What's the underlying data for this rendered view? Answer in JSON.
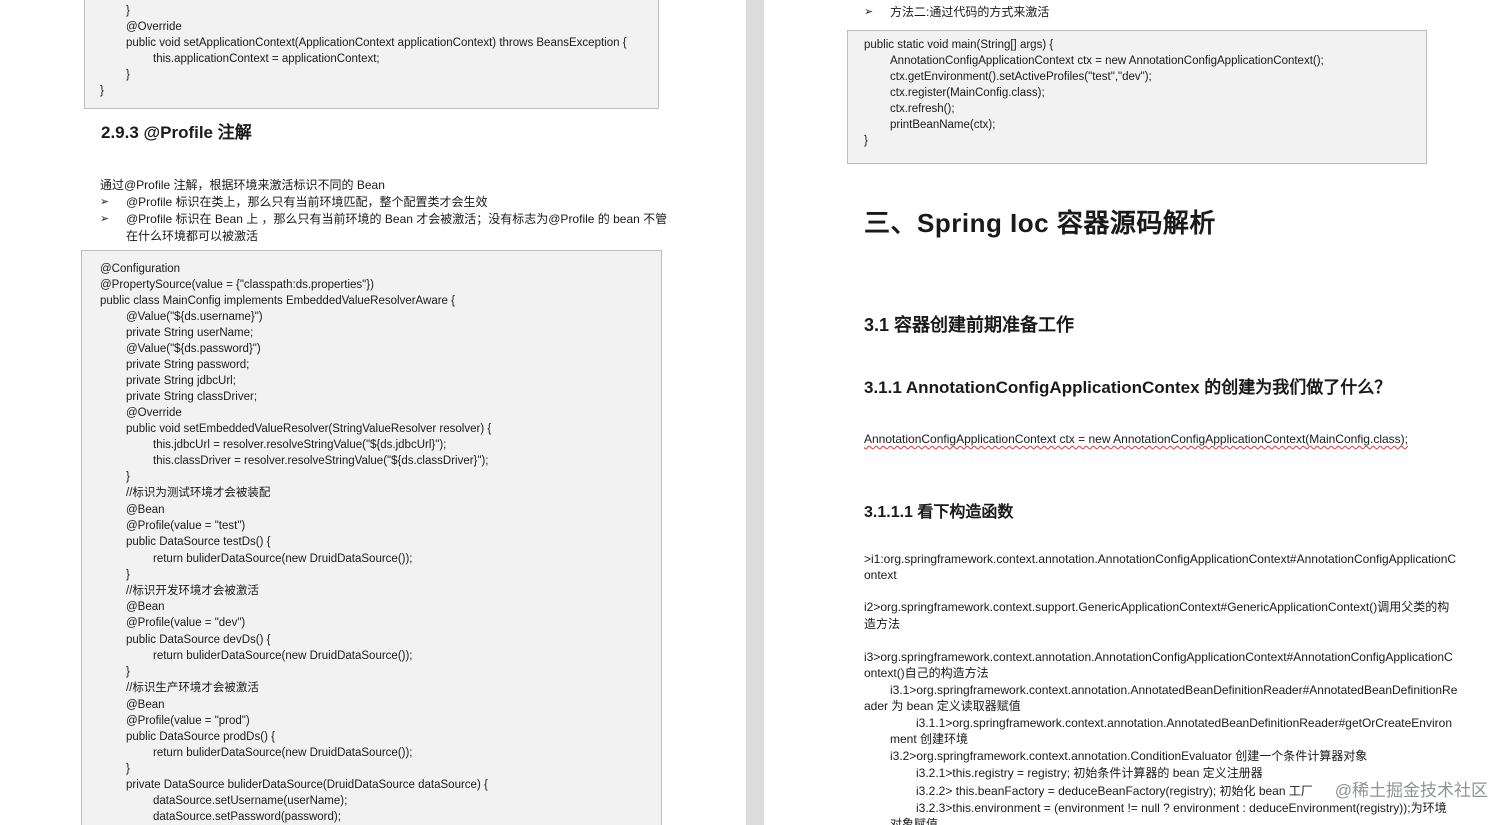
{
  "left_page": {
    "top_code_lines": [
      "}",
      "@Override",
      "public void setApplicationContext(ApplicationContext applicationContext) throws BeansException {",
      "this.applicationContext = applicationContext;",
      "}",
      "}"
    ],
    "section_heading": "2.9.3 @Profile 注解",
    "intro_text": "通过@Profile 注解，根据环境来激活标识不同的 Bean",
    "bullet_marker": "➢",
    "bullets": [
      "@Profile 标识在类上，那么只有当前环境匹配，整个配置类才会生效",
      "@Profile 标识在 Bean 上 ，那么只有当前环境的 Bean 才会被激活；没有标志为@Profile 的 bean  不管",
      "在什么环境都可以被激活"
    ],
    "code_lines": [
      "@Configuration",
      "@PropertySource(value = {\"classpath:ds.properties\"})",
      "public class MainConfig implements EmbeddedValueResolverAware {",
      "@Value(\"${ds.username}\")",
      "private String userName;",
      "@Value(\"${ds.password}\")",
      "private String password;",
      "private String jdbcUrl;",
      "private String classDriver;",
      "@Override",
      "public void setEmbeddedValueResolver(StringValueResolver resolver) {",
      "this.jdbcUrl = resolver.resolveStringValue(\"${ds.jdbcUrl}\");",
      "this.classDriver = resolver.resolveStringValue(\"${ds.classDriver}\");",
      "}",
      "//标识为测试环境才会被装配",
      "@Bean",
      "@Profile(value = \"test\")",
      "public DataSource testDs() {",
      "return buliderDataSource(new DruidDataSource());",
      "}",
      "//标识开发环境才会被激活",
      "@Bean",
      "@Profile(value = \"dev\")",
      "public DataSource devDs() {",
      "return buliderDataSource(new DruidDataSource());",
      "}",
      "//标识生产环境才会被激活",
      "@Bean",
      "@Profile(value = \"prod\")",
      "public DataSource prodDs() {",
      "return buliderDataSource(new DruidDataSource());",
      "}",
      "private DataSource buliderDataSource(DruidDataSource dataSource) {",
      "dataSource.setUsername(userName);",
      "dataSource.setPassword(password);"
    ]
  },
  "right_page": {
    "bullet_marker": "➢",
    "method_two": "方法二:通过代码的方式来激活",
    "code_lines": [
      "public static void main(String[] args) {",
      "AnnotationConfigApplicationContext ctx = new AnnotationConfigApplicationContext();",
      "ctx.getEnvironment().setActiveProfiles(\"test\",\"dev\");",
      "ctx.register(MainConfig.class);",
      "ctx.refresh();",
      "printBeanName(ctx);",
      "}"
    ],
    "chapter_heading": "三、Spring Ioc 容器源码解析",
    "heading_3_1": "3.1  容器创建前期准备工作",
    "heading_3_1_1": "3.1.1 AnnotationConfigApplicationContex 的创建为我们做了什么？",
    "ctx_line": "AnnotationConfigApplicationContext ctx = new AnnotationConfigApplicationContext(MainConfig.class);",
    "heading_3_1_1_1": "3.1.1.1 看下构造函数",
    "body_lines": [
      ">i1:org.springframework.context.annotation.AnnotationConfigApplicationContext#AnnotationConfigApplicationC",
      "ontext",
      "i2>org.springframework.context.support.GenericApplicationContext#GenericApplicationContext()调用父类的构",
      "造方法",
      "i3>org.springframework.context.annotation.AnnotationConfigApplicationContext#AnnotationConfigApplicationC",
      "ontext()自己的构造方法",
      "i3.1>org.springframework.context.annotation.AnnotatedBeanDefinitionReader#AnnotatedBeanDefinitionRe",
      "ader 为 bean 定义读取器赋值",
      "i3.1.1>org.springframework.context.annotation.AnnotatedBeanDefinitionReader#getOrCreateEnviron",
      "ment 创建环境",
      "i3.2>org.springframework.context.annotation.ConditionEvaluator 创建一个条件计算器对象",
      "i3.2.1>this.registry = registry;   初始条件计算器的 bean 定义注册器",
      "i3.2.2> this.beanFactory = deduceBeanFactory(registry);  初始化 bean 工厂",
      "i3.2.3>this.environment = (environment != null ? environment : deduceEnvironment(registry));为环境",
      "对象赋值"
    ],
    "watermark": "@稀土掘金技术社区"
  }
}
